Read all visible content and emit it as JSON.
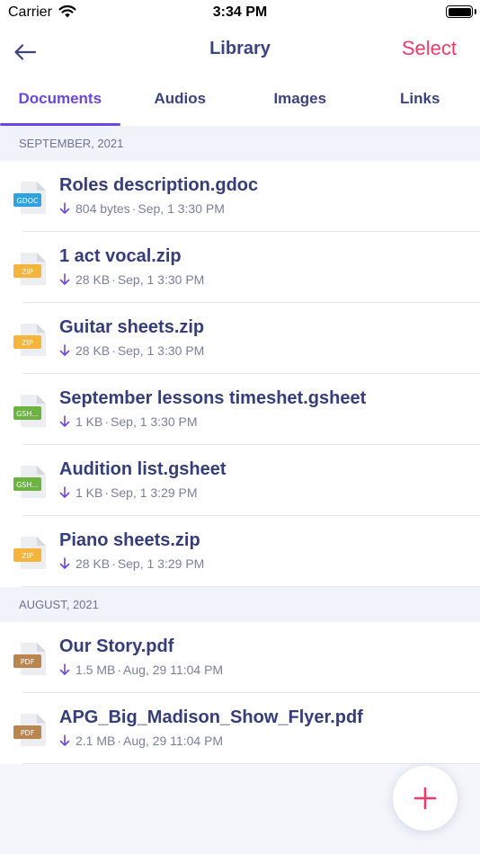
{
  "status_bar": {
    "carrier": "Carrier",
    "time": "3:34 PM"
  },
  "nav": {
    "title": "Library",
    "select_label": "Select"
  },
  "tabs": [
    {
      "label": "Documents",
      "active": true
    },
    {
      "label": "Audios",
      "active": false
    },
    {
      "label": "Images",
      "active": false
    },
    {
      "label": "Links",
      "active": false
    }
  ],
  "sections": [
    {
      "header": "SEPTEMBER, 2021",
      "files": [
        {
          "name": "Roles description.gdoc",
          "size": "804 bytes",
          "date": "Sep, 1 3:30 PM",
          "badge": "GDOC",
          "badge_color": "#2fa3e0"
        },
        {
          "name": "1 act vocal.zip",
          "size": "28 KB",
          "date": "Sep, 1 3:30 PM",
          "badge": "ZIP",
          "badge_color": "#f5b53c"
        },
        {
          "name": "Guitar sheets.zip",
          "size": "28 KB",
          "date": "Sep, 1 3:30 PM",
          "badge": "ZIP",
          "badge_color": "#f5b53c"
        },
        {
          "name": "September lessons timeshet.gsheet",
          "size": "1 KB",
          "date": "Sep, 1 3:30 PM",
          "badge": "GSH...",
          "badge_color": "#6cb33f"
        },
        {
          "name": "Audition list.gsheet",
          "size": "1 KB",
          "date": "Sep, 1 3:29 PM",
          "badge": "GSH...",
          "badge_color": "#6cb33f"
        },
        {
          "name": "Piano sheets.zip",
          "size": "28 KB",
          "date": "Sep, 1 3:29 PM",
          "badge": "ZIP",
          "badge_color": "#f5b53c"
        }
      ]
    },
    {
      "header": "AUGUST, 2021",
      "files": [
        {
          "name": "Our Story.pdf",
          "size": "1.5 MB",
          "date": "Aug, 29 11:04 PM",
          "badge": "PDF",
          "badge_color": "#b8864e"
        },
        {
          "name": "APG_Big_Madison_Show_Flyer.pdf",
          "size": "2.1 MB",
          "date": "Aug, 29 11:04 PM",
          "badge": "PDF",
          "badge_color": "#b8864e"
        }
      ]
    }
  ],
  "colors": {
    "accent": "#6b47dc",
    "select": "#ef3a6a",
    "title": "#353d7a",
    "fab_plus": "#ef3a6a"
  },
  "icons": {
    "back": "arrow-left-icon",
    "download": "arrow-down-icon",
    "fab": "plus-icon",
    "wifi": "wifi-icon",
    "battery": "battery-icon"
  }
}
